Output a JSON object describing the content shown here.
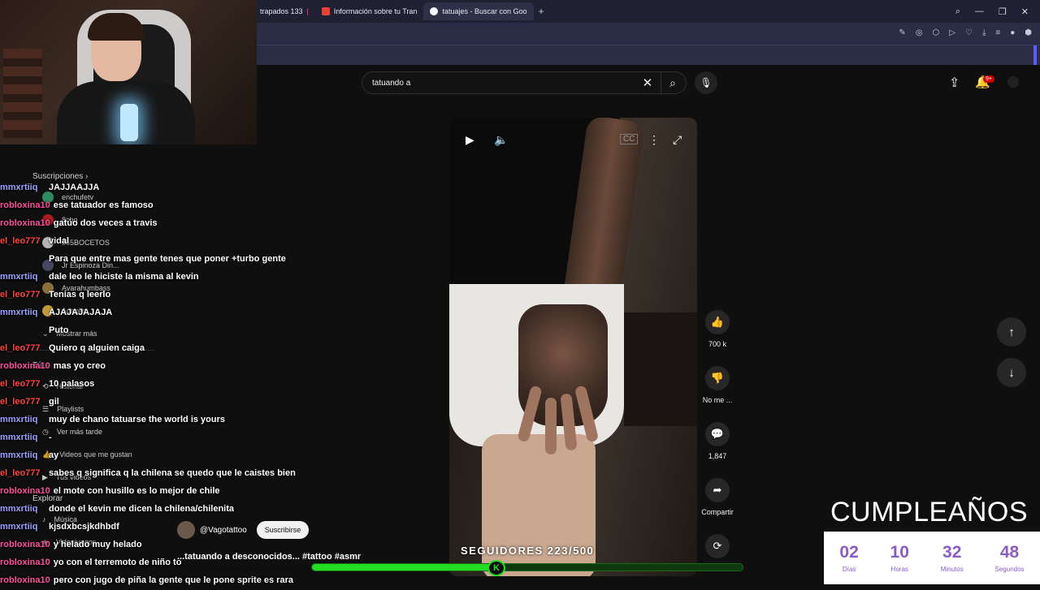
{
  "browser": {
    "tabs": [
      {
        "label": "trapados 133",
        "color": "#9146ff"
      },
      {
        "label": "Información sobre tu Tran",
        "color": "#ea4335"
      },
      {
        "label": "tatuajes - Buscar con Goo",
        "color": "#4285f4"
      }
    ],
    "new_tab": "+"
  },
  "search": {
    "query": "tatuando a"
  },
  "notifications": {
    "badge": "9+"
  },
  "sidebar": {
    "subscriptions_label": "Suscripciones",
    "items": [
      "enchufetv",
      "8cho",
      "365BOCETOS",
      "Jr Espinoza Din...",
      "Avarahumbass",
      "Agapito"
    ],
    "show_more": "Mostrar más",
    "you": "Tú",
    "history": "Historial",
    "playlists": "Playlists",
    "watch_later": "Ver más tarde",
    "liked": "Videos que me gustan",
    "your_videos": "Tus videos",
    "explore": "Explorar",
    "music": "Música",
    "games": "Videojuegos"
  },
  "chat": [
    {
      "user": "mmxrtiiq",
      "text": "JAJJAAJJA",
      "color": "#9aa0ff"
    },
    {
      "user": "robloxina10",
      "text": "ese tatuador es famoso",
      "color": "#ff4fa0"
    },
    {
      "user": "robloxina10",
      "text": "gatúo dos veces a travis",
      "color": "#ff4fa0"
    },
    {
      "user": "el_leo777",
      "text": "vidal",
      "color": "#ff4444"
    },
    {
      "user": "",
      "text": "Para que entre mas gente tenes que poner +turbo gente",
      "color": "#ff4444"
    },
    {
      "user": "mmxrtiiq",
      "text": "dale leo le hiciste la misma al kevin",
      "color": "#9aa0ff"
    },
    {
      "user": "el_leo777",
      "text": "Tenias q leerlo",
      "color": "#ff4444"
    },
    {
      "user": "mmxrtiiq",
      "text": "AJAJAJAJAJA",
      "color": "#9aa0ff"
    },
    {
      "user": "",
      "text": "Puto",
      "color": "#ff4444"
    },
    {
      "user": "el_leo777",
      "text": "Quiero q alguien caiga",
      "color": "#ff4444"
    },
    {
      "user": "robloxina10",
      "text": "mas yo creo",
      "color": "#ff4fa0"
    },
    {
      "user": "el_leo777",
      "text": "10 palasos",
      "color": "#ff4444"
    },
    {
      "user": "el_leo777",
      "text": "gil",
      "color": "#ff4444"
    },
    {
      "user": "mmxrtiiq",
      "text": "muy de chano tatuarse the world is yours",
      "color": "#9aa0ff"
    },
    {
      "user": "mmxrtiiq",
      "text": "-",
      "color": "#9aa0ff"
    },
    {
      "user": "mmxrtiiq",
      "text": "ay",
      "color": "#9aa0ff"
    },
    {
      "user": "el_leo777",
      "text": "sabes q significa q la chilena se quedo que le caistes bien",
      "color": "#ff4444"
    },
    {
      "user": "robloxina10",
      "text": "el mote con husillo es lo mejor de chile",
      "color": "#ff4fa0"
    },
    {
      "user": "mmxrtiiq",
      "text": "donde el kevin me dicen la chilena/chilenita",
      "color": "#9aa0ff"
    },
    {
      "user": "mmxrtiiq",
      "text": "kjsdxbcsjkdhbdf",
      "color": "#9aa0ff"
    },
    {
      "user": "robloxina10",
      "text": "y helado muy helado",
      "color": "#ff4fa0"
    },
    {
      "user": "robloxina10",
      "text": "yo con el terremoto de niño to",
      "color": "#ff4fa0"
    },
    {
      "user": "robloxina10",
      "text": "pero con jugo de piña la gente que le pone sprite es rara",
      "color": "#ff4fa0"
    }
  ],
  "short": {
    "channel": "@Vagotattoo",
    "subscribe": "Suscribirse",
    "caption": "...tatuando a desconocidos... #tattoo #asmr",
    "likes": "700 k",
    "dislike": "No me ...",
    "comments": "1,847",
    "share": "Compartir",
    "remix": "3"
  },
  "overlay": {
    "followers_label": "SEGUIDORES 223/500",
    "followers_current": 223,
    "followers_goal": 500,
    "birthday_title": "CUMPLEAÑOS",
    "countdown": [
      {
        "value": "02",
        "label": "Días"
      },
      {
        "value": "10",
        "label": "Horas"
      },
      {
        "value": "32",
        "label": "Minutos"
      },
      {
        "value": "48",
        "label": "Segundos"
      }
    ]
  }
}
